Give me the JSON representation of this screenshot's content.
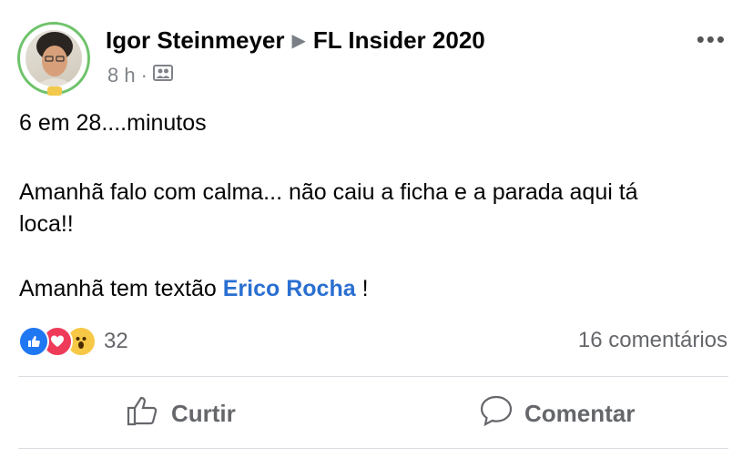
{
  "post": {
    "author": "Igor Steinmeyer",
    "group": "FL Insider 2020",
    "time": "8 h",
    "privacy_icon": "group-icon",
    "lines": [
      "6 em 28....minutos",
      "Amanhã falo com calma... não caiu a ficha e a parada aqui tá",
      "loca!!"
    ],
    "mention_prefix": "Amanhã tem textão",
    "mention": "Erico Rocha",
    "mention_suffix": " !"
  },
  "reactions": {
    "icons": [
      "like-icon",
      "love-icon",
      "wow-icon"
    ],
    "count": "32",
    "comments": "16 comentários"
  },
  "actions": {
    "like_label": "Curtir",
    "comment_label": "Comentar"
  },
  "colors": {
    "link": "#2a6fd1",
    "muted": "#65676b",
    "avatar_ring": "#6fc36b"
  }
}
